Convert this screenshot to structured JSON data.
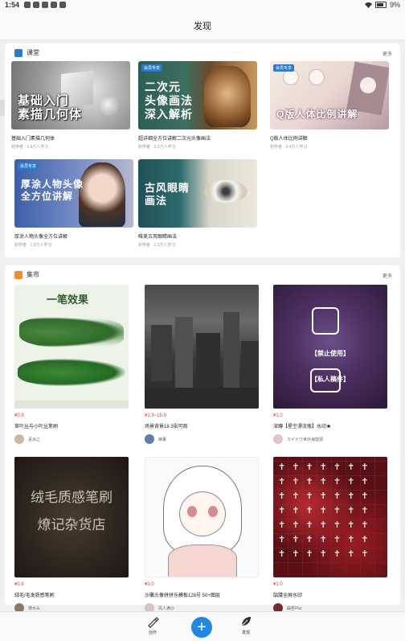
{
  "status": {
    "time": "1:54",
    "battery": "9%"
  },
  "header": {
    "title": "发现"
  },
  "classroom": {
    "title": "课堂",
    "more": "更多",
    "courses": [
      {
        "tag": "",
        "overlay": "基础入门\n素描几何体",
        "name": "基础入门素描几何体",
        "meta": "初学者 · 1.8万人学习"
      },
      {
        "tag": "会员专享",
        "overlay": "二次元\n头像画法\n深入解析",
        "name": "超详细全方位讲解二次元头像画法",
        "meta": "初学者 · 5.3万人学习"
      },
      {
        "tag": "会员专享",
        "overlay": "Q版人体比例讲解",
        "name": "Q版人体比例讲解",
        "meta": "初学者 · 3.4万人学习"
      },
      {
        "tag": "会员专享",
        "overlay": "厚涂人物头像\n全方位讲解",
        "name": "厚涂人物头像全方位讲解",
        "meta": "初学者 · 1.6万人学习"
      },
      {
        "tag": "",
        "overlay": "古风眼睛\n画法",
        "name": "唯美古风眼睛画法",
        "meta": "初学者 · 1.3万人学习"
      }
    ]
  },
  "market": {
    "title": "集市",
    "more": "更多",
    "items": [
      {
        "price": "¥0.9",
        "name": "草叶丛与小叶丛笔刷",
        "seller": "喜派之",
        "art": "一笔效果"
      },
      {
        "price": "¥1.9~15.0",
        "name": "场景背景18 3张可商",
        "seller": "峰董",
        "art": ""
      },
      {
        "price": "¥1.0",
        "name": "深蹲【星空漂流瓶】水印★",
        "seller": "カイドウ世外海望源",
        "art": "【禁止使用】\n【私人稿件】"
      },
      {
        "price": "¥0.6",
        "name": "绒毛/毛发质感笔刷",
        "seller": "燎木头",
        "art": "绒毛质感笔刷\n燎记杂货店"
      },
      {
        "price": "¥3.0",
        "name": "沙雕头像拼拼乐模板128号 50+图层",
        "seller": "风人满沙",
        "art": ""
      },
      {
        "price": "¥1.0",
        "name": "骷髅全屏水印",
        "seller": "曲哲Plei",
        "art": ""
      }
    ]
  },
  "bottom_nav": {
    "create": "创作",
    "discover": "发现"
  },
  "colors": {
    "accent": "#1e88e5",
    "price": "#e53935",
    "tag": "#2b7ad0"
  }
}
